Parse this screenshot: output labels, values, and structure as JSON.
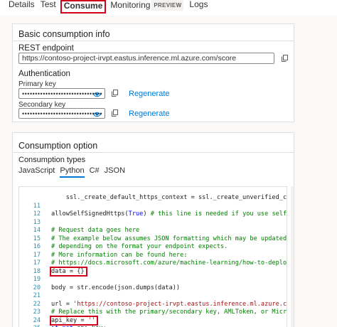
{
  "tabs": {
    "details": "Details",
    "test": "Test",
    "consume": "Consume",
    "monitoring": "Monitoring",
    "preview_badge": "PREVIEW",
    "logs": "Logs"
  },
  "basic": {
    "title": "Basic consumption info",
    "rest_label": "REST endpoint",
    "rest_value": "https://contoso-project-irvpt.eastus.inference.ml.azure.com/score",
    "auth_label": "Authentication",
    "primary_label": "Primary key",
    "primary_value": "•••••••••••••••••••••••••••••••",
    "secondary_label": "Secondary key",
    "secondary_value": "•••••••••••••••••••••••••••••••",
    "regenerate": "Regenerate"
  },
  "option": {
    "title": "Consumption option",
    "types_label": "Consumption types",
    "types": [
      "JavaScript",
      "Python",
      "C#",
      "JSON"
    ],
    "active_type": "Python"
  },
  "code_lines": [
    {
      "n": "",
      "t": "    ssl._create_default_https_context = ssl._create_unverified_contex"
    },
    {
      "n": "11",
      "t": ""
    },
    {
      "n": "12",
      "t": "allowSelfSignedHttps(True) # this line is needed if you use self-signed c"
    },
    {
      "n": "13",
      "t": ""
    },
    {
      "n": "14",
      "t": "# Request data goes here"
    },
    {
      "n": "15",
      "t": "# The example below assumes JSON formatting which may be updated"
    },
    {
      "n": "16",
      "t": "# depending on the format your endpoint expects."
    },
    {
      "n": "17",
      "t": "# More information can be found here:"
    },
    {
      "n": "17",
      "t": "# https://docs.microsoft.com/azure/machine-learning/how-to-deploy-advance"
    },
    {
      "n": "18",
      "t": "data = {}"
    },
    {
      "n": "19",
      "t": ""
    },
    {
      "n": "20",
      "t": "body = str.encode(json.dumps(data))"
    },
    {
      "n": "21",
      "t": ""
    },
    {
      "n": "22",
      "t": "url = 'https://contoso-project-irvpt.eastus.inference.ml.azure.com/score'"
    },
    {
      "n": "23",
      "t": "# Replace this with the primary/secondary key, AMLToken, or Microsoft Ent"
    },
    {
      "n": "24",
      "t": "api_key = ''"
    },
    {
      "n": "25",
      "t": "if not api_key:"
    }
  ]
}
